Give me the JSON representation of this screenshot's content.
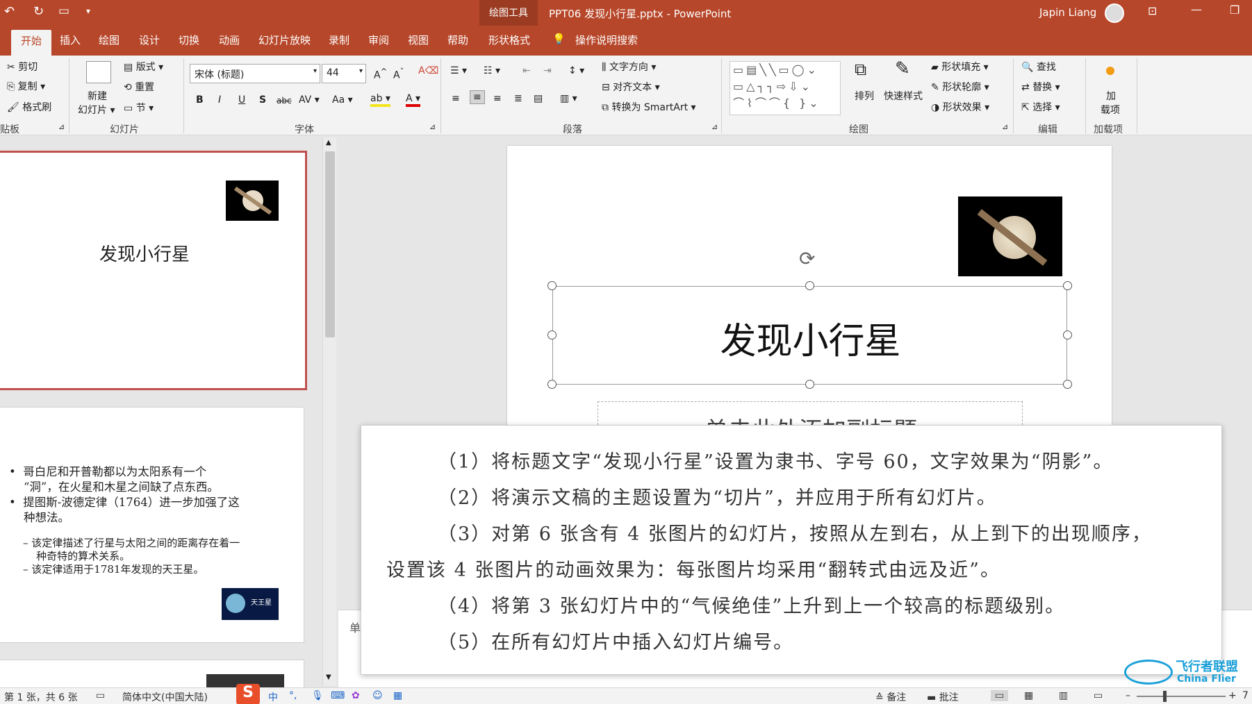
{
  "window": {
    "title": "PPT06 发现小行星.pptx  -  PowerPoint",
    "context_tab_group": "绘图工具",
    "user": "Japin Liang"
  },
  "tabs": [
    "开始",
    "插入",
    "绘图",
    "设计",
    "切换",
    "动画",
    "幻灯片放映",
    "录制",
    "审阅",
    "视图",
    "帮助",
    "形状格式"
  ],
  "tell_me": "操作说明搜索",
  "ribbon": {
    "clipboard": {
      "cut": "剪切",
      "copy": "复制",
      "format_painter": "格式刷",
      "label": "贴板"
    },
    "slides": {
      "new_slide_1": "新建",
      "new_slide_2": "幻灯片",
      "layout": "版式",
      "reset": "重置",
      "section": "节",
      "label": "幻灯片"
    },
    "font": {
      "font_name": "宋体 (标题)",
      "font_size": "44",
      "bold": "B",
      "italic": "I",
      "underline": "U",
      "shadow": "S",
      "strike": "abc",
      "spacing": "AV",
      "case": "Aa",
      "label": "字体"
    },
    "paragraph": {
      "text_direction": "文字方向",
      "align_text": "对齐文本",
      "smartart": "转换为 SmartArt",
      "label": "段落"
    },
    "drawing": {
      "arrange": "排列",
      "quick_styles": "快速样式",
      "fill": "形状填充",
      "outline": "形状轮廓",
      "effects": "形状效果",
      "label": "绘图"
    },
    "editing": {
      "find": "查找",
      "replace": "替换",
      "select": "选择",
      "label": "编辑"
    },
    "addins": {
      "add_1": "加",
      "add_2": "载项",
      "label": "加载项"
    }
  },
  "thumbnails": {
    "slide1_title": "发现小行星",
    "slide2_bullets": [
      "哥白尼和开普勒都以为太阳系有一个",
      "“洞”，在火星和木星之间缺了点东西。",
      "提图斯-波德定律（1764）进一步加强了这",
      "种想法。"
    ],
    "slide2_sub": [
      "该定律描述了行星与太阳之间的距离存在着一",
      "种奇特的算术关系。",
      "该定律适用于1781年发现的天王星。"
    ],
    "uranus_label": "天王星"
  },
  "slide": {
    "title": "发现小行星",
    "subtitle_placeholder": "单击此处添加副标题",
    "notes_placeholder": "单"
  },
  "instructions": {
    "line1": "（1）将标题文字“发现小行星”设置为隶书、字号 60，文字效果为“阴影”。",
    "line2": "（2）将演示文稿的主题设置为“切片”，并应用于所有幻灯片。",
    "line3a": "（3）对第 6 张含有 4 张图片的幻灯片，按照从左到右，从上到下的出现顺序，",
    "line3b": "设置该 4 张图片的动画效果为：每张图片均采用“翻转式由远及近”。",
    "line4": "（4）将第 3 张幻灯片中的“气候绝佳”上升到上一个较高的标题级别。",
    "line5": "（5）在所有幻灯片中插入幻灯片编号。"
  },
  "status": {
    "slide_pos": "第 1 张，共 6 张",
    "language": "简体中文(中国大陆)",
    "ime": "中",
    "notes": "备注",
    "comments": "批注",
    "zoom_tail": "7"
  },
  "watermark": {
    "cn": "飞行者联盟",
    "en": "China Flier"
  },
  "colors": {
    "accent": "#b7472a",
    "ribbon_bg": "#f3f3f3"
  }
}
